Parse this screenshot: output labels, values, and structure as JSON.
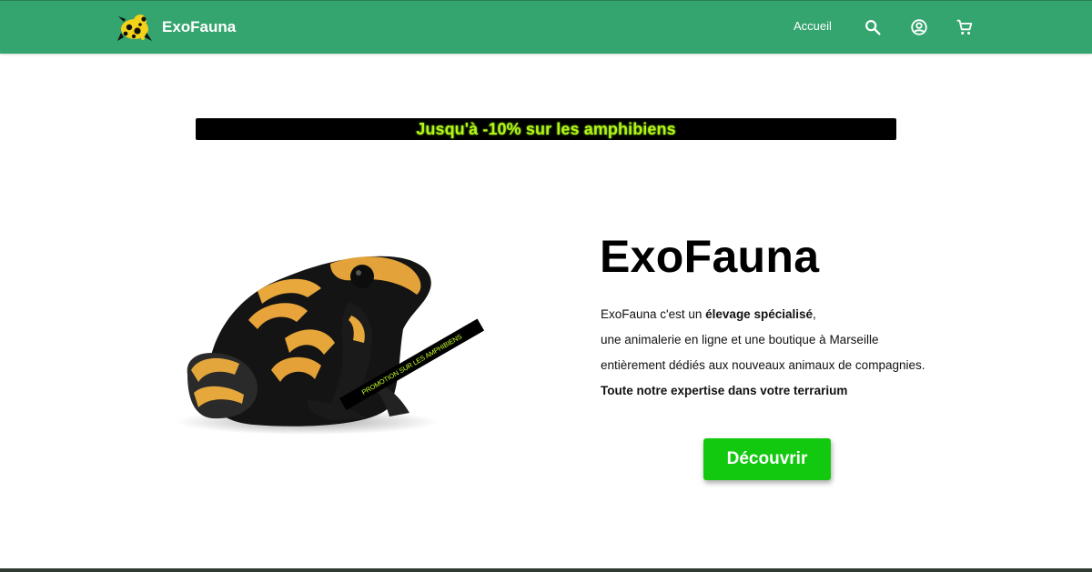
{
  "header": {
    "brand_name": "ExoFauna",
    "brand_logo_icon": "poison-dart-frog-logo",
    "nav_home_label": "Accueil",
    "icons": [
      "search-icon",
      "account-icon",
      "cart-icon"
    ],
    "background_color": "#34a56e"
  },
  "promo": {
    "banner_text": "Jusqu'à -10% sur les amphibiens",
    "ribbon_text": "PROMOTION SUR LES AMPHIBIENS",
    "text_color": "#b6f21b"
  },
  "hero": {
    "title": "ExoFauna",
    "line1_prefix": "ExoFauna c'est un ",
    "line1_bold": "élevage spécialisé",
    "line1_suffix": ",",
    "line2": "une animalerie en ligne et une boutique à Marseille",
    "line3": "entièrement dédiés aux nouveaux animaux de compagnies.",
    "line4": "Toute notre expertise dans votre terrarium",
    "cta_label": "Découvrir",
    "cta_color": "#13c90f",
    "image_subject": "yellow-and-black poison dart frog"
  }
}
